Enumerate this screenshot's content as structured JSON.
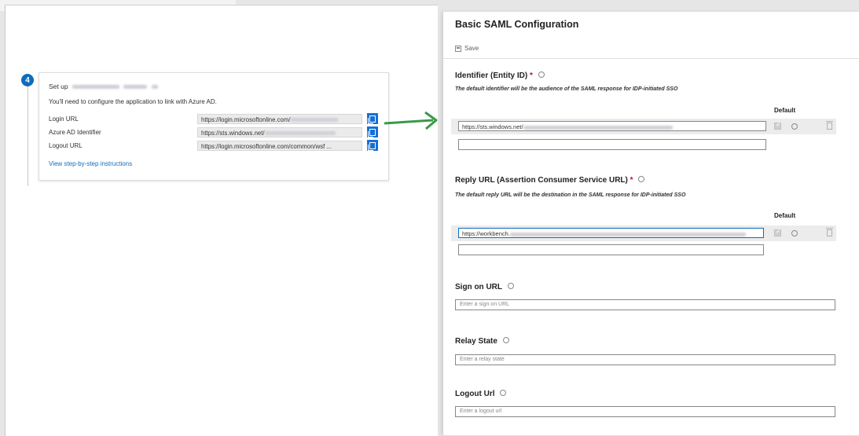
{
  "left": {
    "step_number": "4",
    "title_prefix": "Set up",
    "description": "You'll need to configure the application to link with Azure AD.",
    "rows": [
      {
        "label": "Login URL",
        "value": "https://login.microsoftonline.com/"
      },
      {
        "label": "Azure AD Identifier",
        "value": "https://sts.windows.net/"
      },
      {
        "label": "Logout URL",
        "value": "https://login.microsoftonline.com/common/wsf ..."
      }
    ],
    "instructions_link": "View step-by-step instructions"
  },
  "right": {
    "title": "Basic SAML Configuration",
    "save_label": "Save",
    "identifier": {
      "title": "Identifier (Entity ID)",
      "required": "*",
      "subtitle": "The default identifier will be the audience of the SAML response for IDP-initiated SSO",
      "default_label": "Default",
      "value": "https://sts.windows.net/"
    },
    "reply": {
      "title": "Reply URL (Assertion Consumer Service URL)",
      "required": "*",
      "subtitle": "The default reply URL will be the destination in the SAML response for IDP-initiated SSO",
      "default_label": "Default",
      "value": "https://workbench."
    },
    "sign_on": {
      "title": "Sign on URL",
      "placeholder": "Enter a sign on URL"
    },
    "relay": {
      "title": "Relay State",
      "placeholder": "Enter a relay state"
    },
    "logout": {
      "title": "Logout Url",
      "placeholder": "Enter a logout url"
    }
  },
  "colors": {
    "accent": "#0f6cbd",
    "arrow": "#3a9a48",
    "required": "#c50f1f"
  }
}
